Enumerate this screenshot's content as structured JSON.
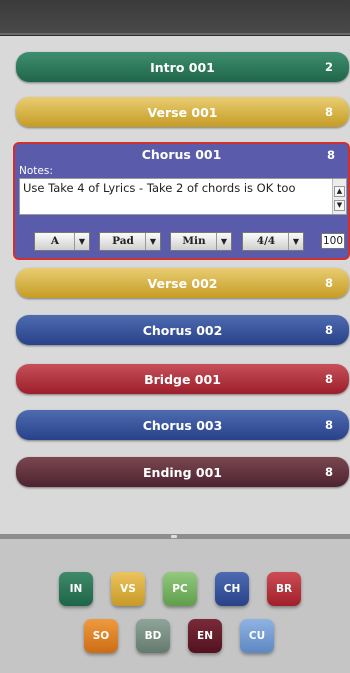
{
  "sections": [
    {
      "name": "Intro 001",
      "count": "2",
      "color": "#2d7a5b"
    },
    {
      "name": "Verse 001",
      "count": "8",
      "color": "#d8b54a"
    },
    {
      "name": "Chorus 001",
      "count": "8",
      "color": "#5b5bab"
    },
    {
      "name": "Verse 002",
      "count": "8",
      "color": "#d8b54a"
    },
    {
      "name": "Chorus 002",
      "count": "8",
      "color": "#3a55a0"
    },
    {
      "name": "Bridge 001",
      "count": "8",
      "color": "#b53540"
    },
    {
      "name": "Chorus 003",
      "count": "8",
      "color": "#3a55a0"
    },
    {
      "name": "Ending 001",
      "count": "8",
      "color": "#5e3039"
    }
  ],
  "editor": {
    "notes_label": "Notes:",
    "notes_text": "Use Take 4 of Lyrics - Take 2 of chords is OK too",
    "key": "A",
    "instrument": "Pad",
    "mode": "Min",
    "time_signature": "4/4",
    "tempo": "100"
  },
  "palette": [
    {
      "code": "IN",
      "color": "#2a7758"
    },
    {
      "code": "VS",
      "color": "#dbb040"
    },
    {
      "code": "PC",
      "color": "#7ab665"
    },
    {
      "code": "CH",
      "color": "#3a55a0"
    },
    {
      "code": "BR",
      "color": "#b83640"
    },
    {
      "code": "SO",
      "color": "#e08428"
    },
    {
      "code": "BD",
      "color": "#7a9085"
    },
    {
      "code": "EN",
      "color": "#66202d"
    },
    {
      "code": "CU",
      "color": "#75a0d4"
    }
  ]
}
